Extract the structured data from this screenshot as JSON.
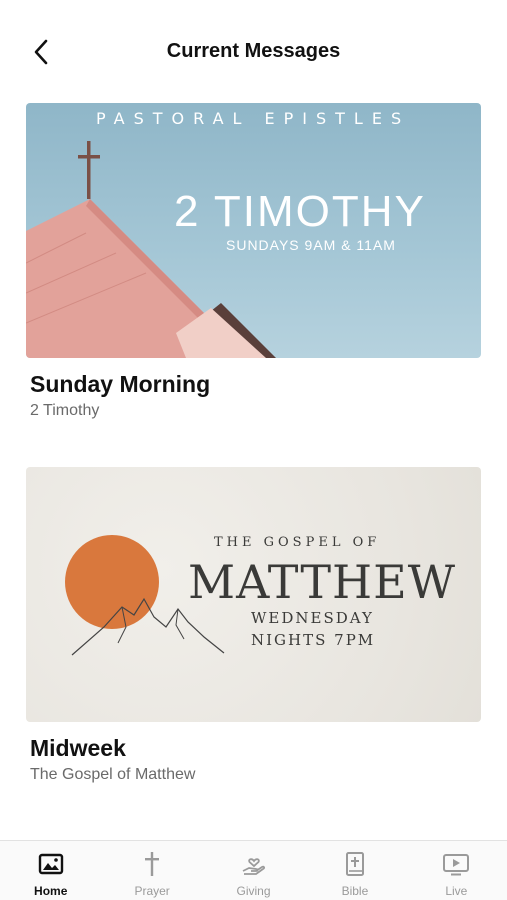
{
  "header": {
    "title": "Current Messages",
    "back_icon": "chevron-left-icon"
  },
  "messages": [
    {
      "title": "Sunday Morning",
      "subtitle": "2 Timothy",
      "banner": {
        "series": "PASTORAL EPISTLES",
        "heading": "2 TIMOTHY",
        "times": "SUNDAYS 9AM & 11AM"
      }
    },
    {
      "title": "Midweek",
      "subtitle": "The Gospel of Matthew",
      "banner": {
        "overline": "THE GOSPEL OF",
        "heading": "MATTHEW",
        "line1": "WEDNESDAY",
        "line2": "NIGHTS 7PM"
      }
    }
  ],
  "tabs": [
    {
      "label": "Home",
      "icon": "image-icon",
      "active": true
    },
    {
      "label": "Prayer",
      "icon": "cross-icon",
      "active": false
    },
    {
      "label": "Giving",
      "icon": "hand-heart-icon",
      "active": false
    },
    {
      "label": "Bible",
      "icon": "bible-icon",
      "active": false
    },
    {
      "label": "Live",
      "icon": "tv-play-icon",
      "active": false
    }
  ],
  "colors": {
    "active_tab": "#111111",
    "inactive_tab": "#9a9a9a",
    "banner1_sky": "#a5c7d6",
    "banner1_roof": "#e2a29a",
    "banner2_sun": "#d9783d"
  }
}
